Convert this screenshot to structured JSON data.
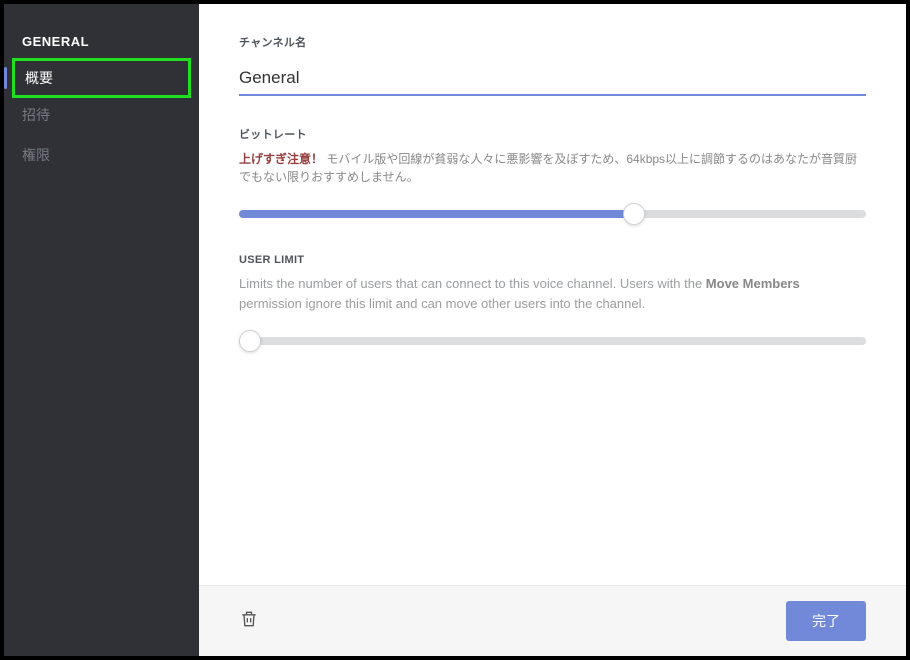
{
  "sidebar": {
    "title": "GENERAL",
    "items": [
      {
        "label": "概要",
        "active": true
      },
      {
        "label": "招待",
        "active": false
      },
      {
        "label": "権限",
        "active": false
      }
    ]
  },
  "channelName": {
    "label": "チャンネル名",
    "value": "General"
  },
  "bitrate": {
    "label": "ビットレート",
    "warning_strong": "上げすぎ注意！",
    "warning_rest": " モバイル版や回線が貧弱な人々に悪影響を及ぼすため、64kbps以上に調節するのはあなたが音質厨でもない限りおすすめしません。",
    "fill_pct": 63
  },
  "userLimit": {
    "label": "USER LIMIT",
    "desc_before": "Limits the number of users that can connect to this voice channel. Users with the ",
    "desc_bold": "Move Members",
    "desc_after": " permission ignore this limit and can move other users into the channel.",
    "fill_pct": 0
  },
  "footer": {
    "done": "完了"
  }
}
